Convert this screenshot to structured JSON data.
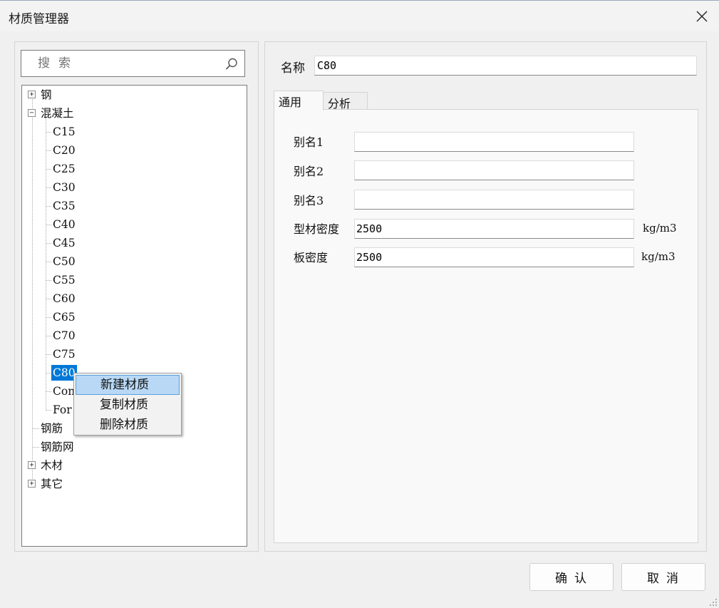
{
  "window": {
    "title": "材质管理器"
  },
  "search": {
    "placeholder": "搜索"
  },
  "tree": {
    "top_items": [
      {
        "label": "钢",
        "expander": "+"
      },
      {
        "label": "混凝土",
        "expander": "−"
      },
      {
        "label": "钢筋"
      },
      {
        "label": "钢筋网"
      },
      {
        "label": "木材",
        "expander": "+"
      },
      {
        "label": "其它",
        "expander": "+"
      }
    ],
    "concrete_children": [
      "C15",
      "C20",
      "C25",
      "C30",
      "C35",
      "C40",
      "C45",
      "C50",
      "C55",
      "C60",
      "C65",
      "C70",
      "C75",
      "C80",
      "Con",
      "For"
    ],
    "selected": "C80"
  },
  "context_menu": {
    "items": [
      "新建材质",
      "复制材质",
      "删除材质"
    ]
  },
  "details": {
    "name_label": "名称",
    "name_value": "C80",
    "tabs": [
      "通用",
      "分析"
    ],
    "fields": [
      {
        "label": "别名1",
        "value": "",
        "unit": ""
      },
      {
        "label": "别名2",
        "value": "",
        "unit": ""
      },
      {
        "label": "别名3",
        "value": "",
        "unit": ""
      },
      {
        "label": "型材密度",
        "value": "2500",
        "unit": "kg/m3"
      },
      {
        "label": "板密度",
        "value": "2500",
        "unit": "kg/m3"
      }
    ]
  },
  "buttons": {
    "ok": "确认",
    "cancel": "取消"
  }
}
